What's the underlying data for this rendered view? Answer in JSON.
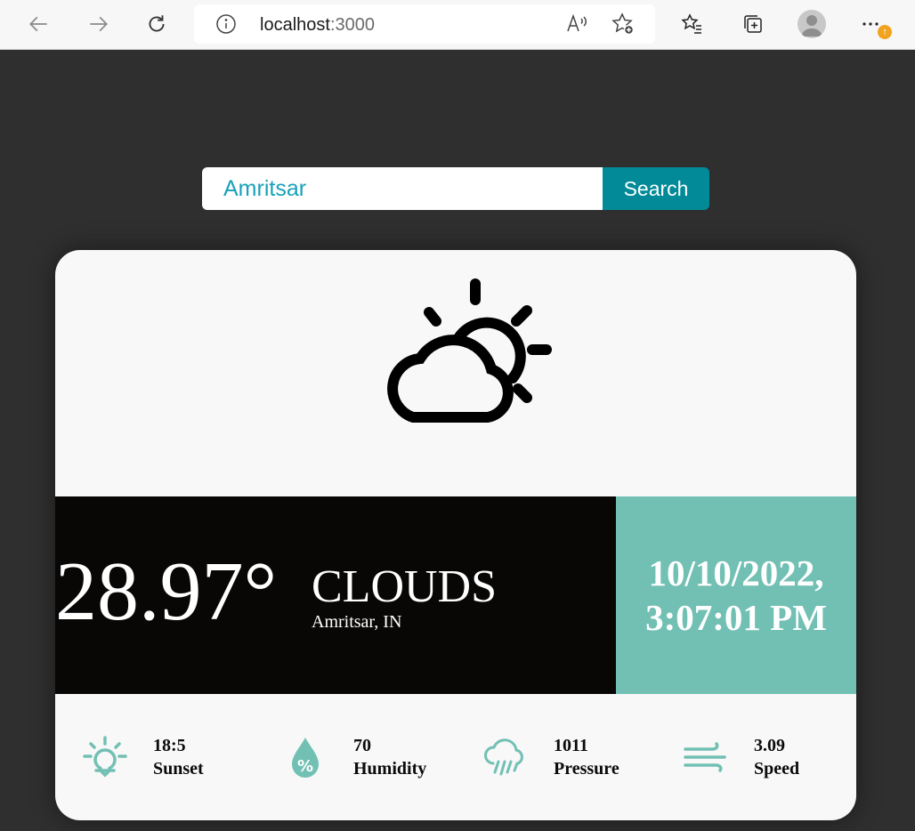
{
  "browser": {
    "url_host": "localhost",
    "url_port": ":3000",
    "update_badge": "↑"
  },
  "search": {
    "value": "Amritsar",
    "button_label": "Search"
  },
  "weather": {
    "temperature": "28.97°",
    "condition": "CLOUDS",
    "location": "Amritsar, IN",
    "date": "10/10/2022,",
    "time": "3:07:01 PM",
    "icon": "cloud-sun-icon"
  },
  "stats": [
    {
      "icon": "sunset-icon",
      "value": "18:5",
      "label": "Sunset"
    },
    {
      "icon": "humidity-icon",
      "value": "70",
      "label": "Humidity"
    },
    {
      "icon": "pressure-icon",
      "value": "1011",
      "label": "Pressure"
    },
    {
      "icon": "wind-icon",
      "value": "3.09",
      "label": "Speed"
    }
  ],
  "colors": {
    "page_background": "#2f2f2f",
    "card_background": "#f8f8f8",
    "accent_teal": "#72c0b4",
    "search_button": "#028a99",
    "search_text": "#17a2b8",
    "info_band": "#080706"
  }
}
